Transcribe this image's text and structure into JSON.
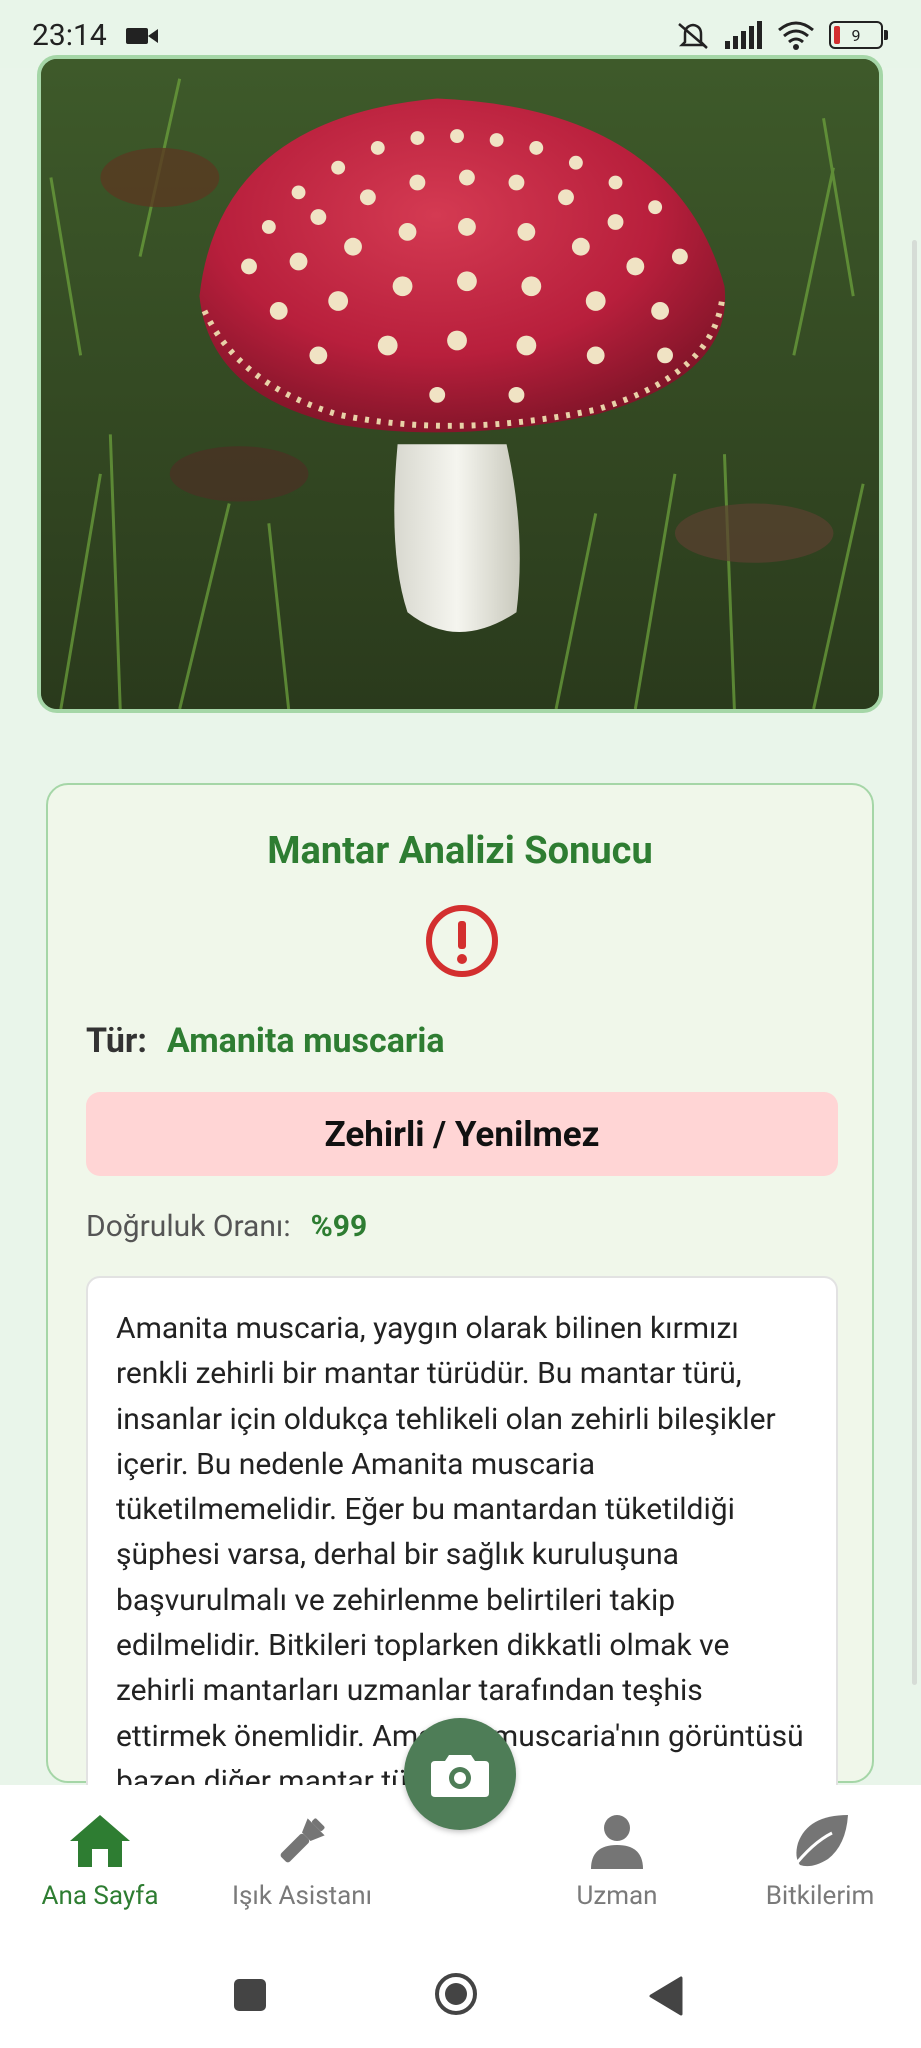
{
  "status_bar": {
    "time": "23:14",
    "battery_level": "9",
    "icons": [
      "video-camera-icon",
      "silent-icon",
      "signal-icon",
      "wifi-icon",
      "battery-icon"
    ]
  },
  "hero_image": {
    "subject": "red mushroom with white spots"
  },
  "result_card": {
    "title": "Mantar Analizi Sonucu",
    "status_icon": "warning-circle-icon",
    "species_label": "Tür:",
    "species_name": "Amanita muscaria",
    "toxicity_label": "Zehirli / Yenilmez",
    "accuracy_label": "Doğruluk Oranı:",
    "accuracy_value": "%99",
    "description": "Amanita muscaria, yaygın olarak bilinen kırmızı renkli zehirli bir mantar türüdür. Bu mantar türü, insanlar için oldukça tehlikeli olan zehirli bileşikler içerir. Bu nedenle Amanita muscaria tüketilmemelidir. Eğer bu mantardan tüketildiği şüphesi varsa, derhal bir sağlık kuruluşuna başvurulmalı ve zehirlenme belirtileri takip edilmelidir. Bitkileri toplarken dikkatli olmak ve zehirli mantarları uzmanlar tarafından teşhis ettirmek önemlidir. Amanita muscaria'nın görüntüsü bazen diğer mantar türleriyle"
  },
  "bottom_nav": {
    "items": [
      {
        "label": "Ana Sayfa",
        "icon": "home-icon",
        "active": true
      },
      {
        "label": "Işık Asistanı",
        "icon": "flashlight-icon",
        "active": false
      },
      {
        "label": "Uzman",
        "icon": "person-icon",
        "active": false
      },
      {
        "label": "Bitkilerim",
        "icon": "leaf-icon",
        "active": false
      }
    ],
    "camera_icon": "camera-icon"
  },
  "colors": {
    "accent_green": "#2e7d32",
    "background": "#e9f5ea",
    "warning_red": "#d32f2f",
    "toxic_badge": "#ffd5d5",
    "fab": "#4e7d57"
  }
}
